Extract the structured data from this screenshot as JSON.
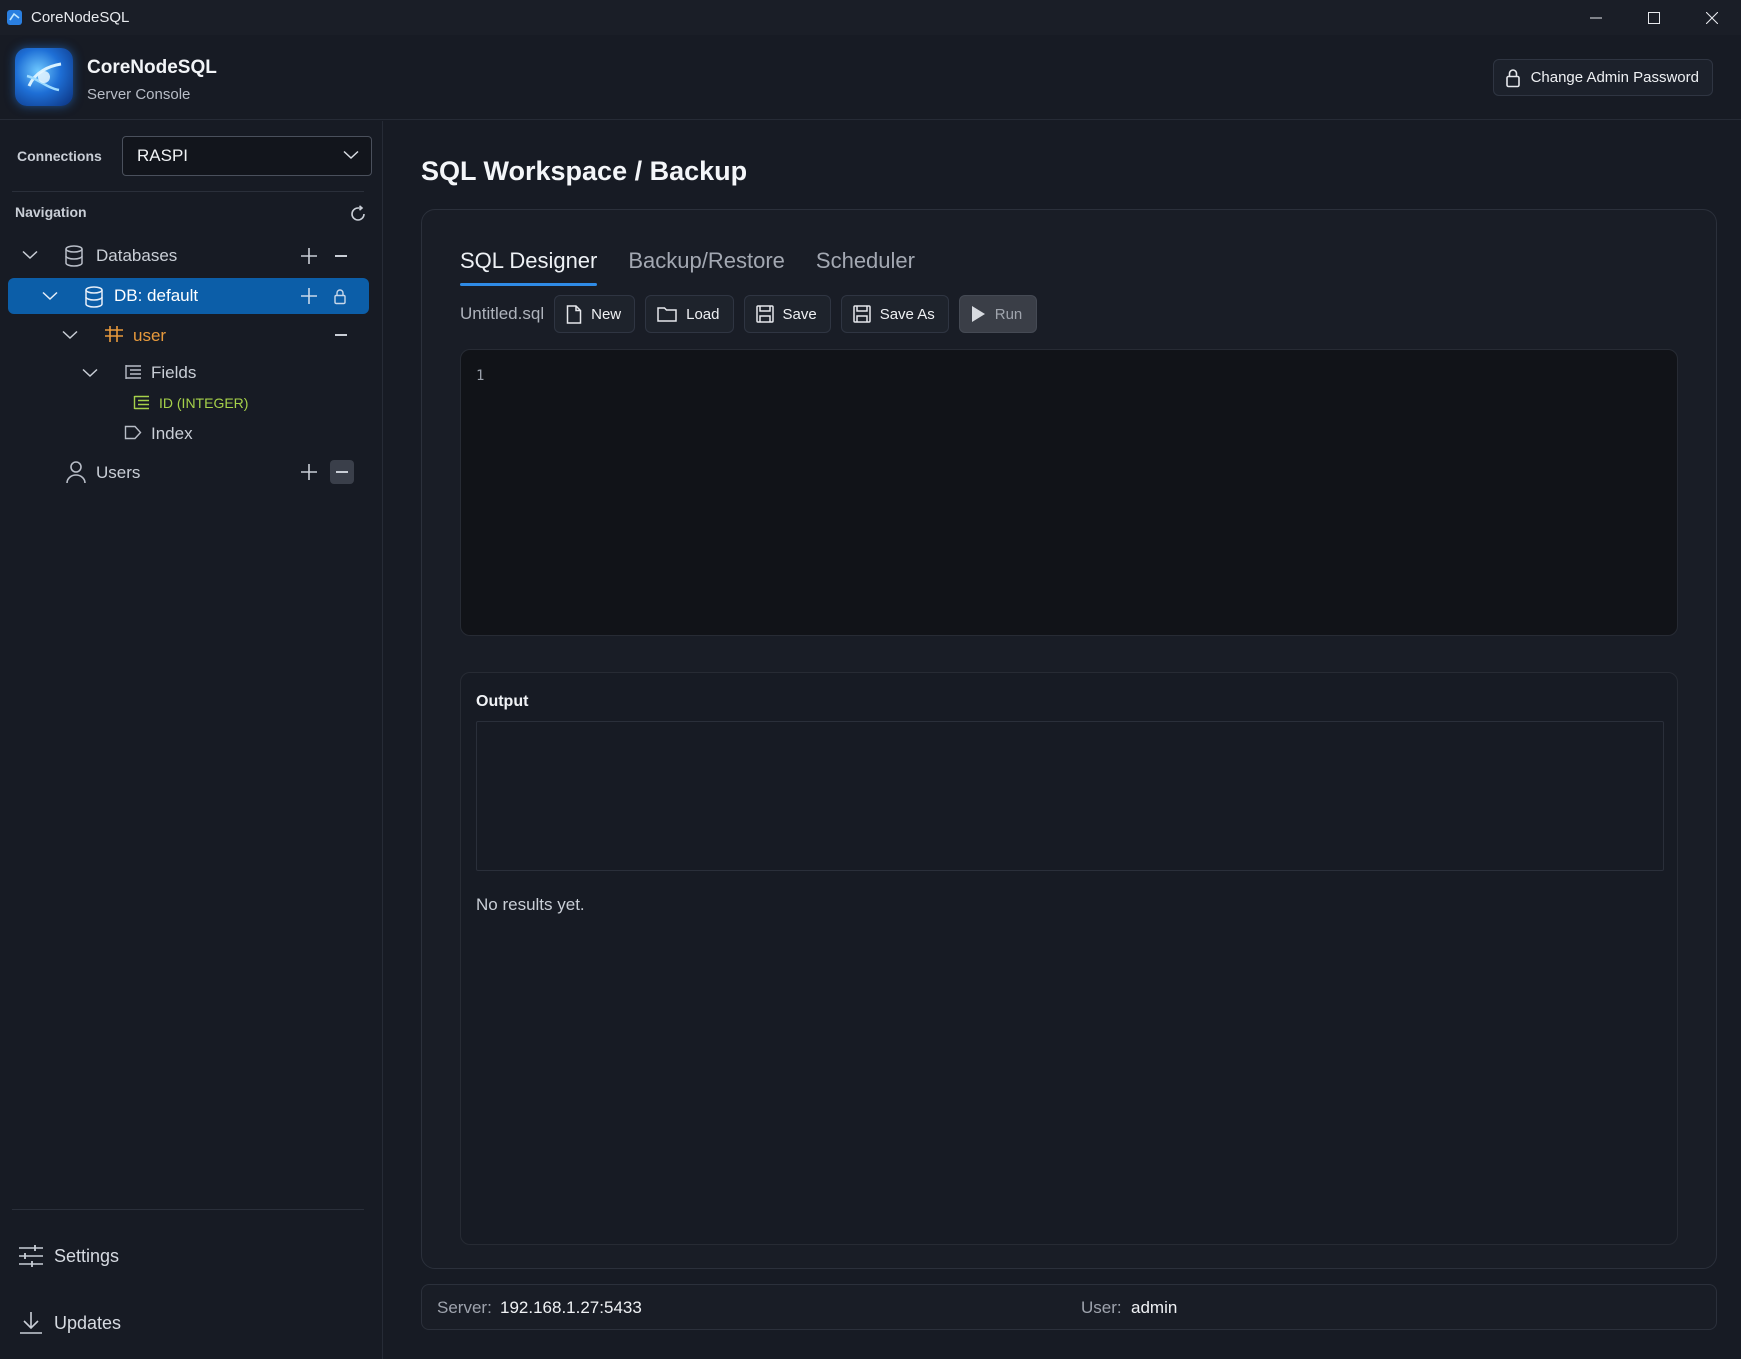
{
  "window": {
    "title": "CoreNodeSQL"
  },
  "header": {
    "app_name": "CoreNodeSQL",
    "app_subtitle": "Server Console",
    "change_password_label": "Change Admin Password"
  },
  "sidebar": {
    "connections_label": "Connections",
    "connection_selected": "RASPI",
    "navigation_label": "Navigation",
    "tree": {
      "databases": "Databases",
      "db": "DB: default",
      "table": "user",
      "fields": "Fields",
      "field_item": "ID (INTEGER)",
      "index": "Index",
      "users": "Users"
    },
    "settings_label": "Settings",
    "updates_label": "Updates"
  },
  "main": {
    "page_title": "SQL Workspace / Backup",
    "tabs": [
      {
        "label": "SQL Designer",
        "active": true
      },
      {
        "label": "Backup/Restore",
        "active": false
      },
      {
        "label": "Scheduler",
        "active": false
      }
    ],
    "toolbar": {
      "filename": "Untitled.sql",
      "new_label": "New",
      "load_label": "Load",
      "save_label": "Save",
      "save_as_label": "Save As",
      "run_label": "Run"
    },
    "editor": {
      "line_number": "1"
    },
    "output": {
      "title": "Output",
      "empty_message": "No results yet."
    }
  },
  "statusbar": {
    "server_label": "Server:",
    "server_value": "192.168.1.27:5433",
    "user_label": "User:",
    "user_value": "admin"
  },
  "colors": {
    "accent": "#2f8be6",
    "selected_row": "#0c5ea8",
    "table_color": "#e89a3c",
    "field_color": "#a6d14a"
  }
}
